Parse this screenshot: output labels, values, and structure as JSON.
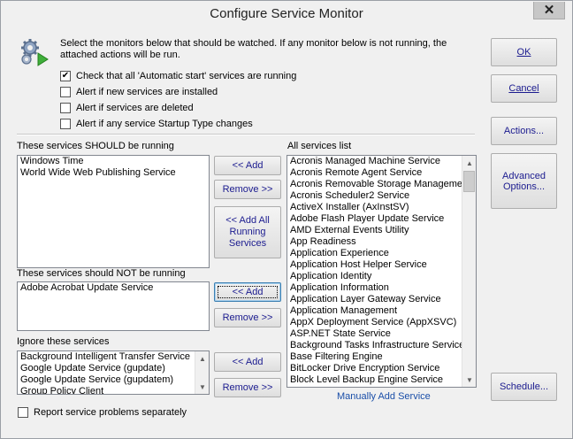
{
  "window": {
    "title": "Configure Service Monitor",
    "close_glyph": "✕"
  },
  "intro": {
    "text": "Select the monitors below that should be watched.  If any monitor below is not running, the attached actions will be run.",
    "icon": "gears-play-icon"
  },
  "checks": [
    {
      "label": "Check that all 'Automatic start' services are running",
      "checked": true
    },
    {
      "label": "Alert if new services are installed",
      "checked": false
    },
    {
      "label": "Alert if services are deleted",
      "checked": false
    },
    {
      "label": "Alert if any service Startup Type changes",
      "checked": false
    }
  ],
  "should_run": {
    "label": "These services SHOULD be running",
    "items": [
      "Windows Time",
      "World Wide Web Publishing Service"
    ],
    "add_label": "<< Add",
    "remove_label": "Remove >>",
    "add_all_label": "<< Add All Running Services"
  },
  "should_not_run": {
    "label": "These services should NOT be running",
    "items": [
      "Adobe Acrobat Update Service"
    ],
    "add_label": "<< Add",
    "remove_label": "Remove >>"
  },
  "ignore": {
    "label": "Ignore these services",
    "items": [
      "Background Intelligent Transfer Service",
      "Google Update Service (gupdate)",
      "Google Update Service (gupdatem)",
      "Group Policy Client"
    ],
    "add_label": "<< Add",
    "remove_label": "Remove >>"
  },
  "all_services": {
    "label": "All services list",
    "items": [
      "Acronis Managed Machine Service",
      "Acronis Remote Agent Service",
      "Acronis Removable Storage Managemen",
      "Acronis Scheduler2 Service",
      "ActiveX Installer (AxInstSV)",
      "Adobe Flash Player Update Service",
      "AMD External Events Utility",
      "App Readiness",
      "Application Experience",
      "Application Host Helper Service",
      "Application Identity",
      "Application Information",
      "Application Layer Gateway Service",
      "Application Management",
      "AppX Deployment Service (AppXSVC)",
      "ASP.NET State Service",
      "Background Tasks Infrastructure Service",
      "Base Filtering Engine",
      "BitLocker Drive Encryption Service",
      "Block Level Backup Engine Service"
    ],
    "manual_add_label": "Manually Add Service"
  },
  "report_separately": {
    "label": "Report service problems separately",
    "checked": false
  },
  "right_buttons": {
    "ok_label": "OK",
    "cancel_label": "Cancel",
    "actions_label": "Actions...",
    "advanced_label": "Advanced Options...",
    "schedule_label": "Schedule..."
  }
}
